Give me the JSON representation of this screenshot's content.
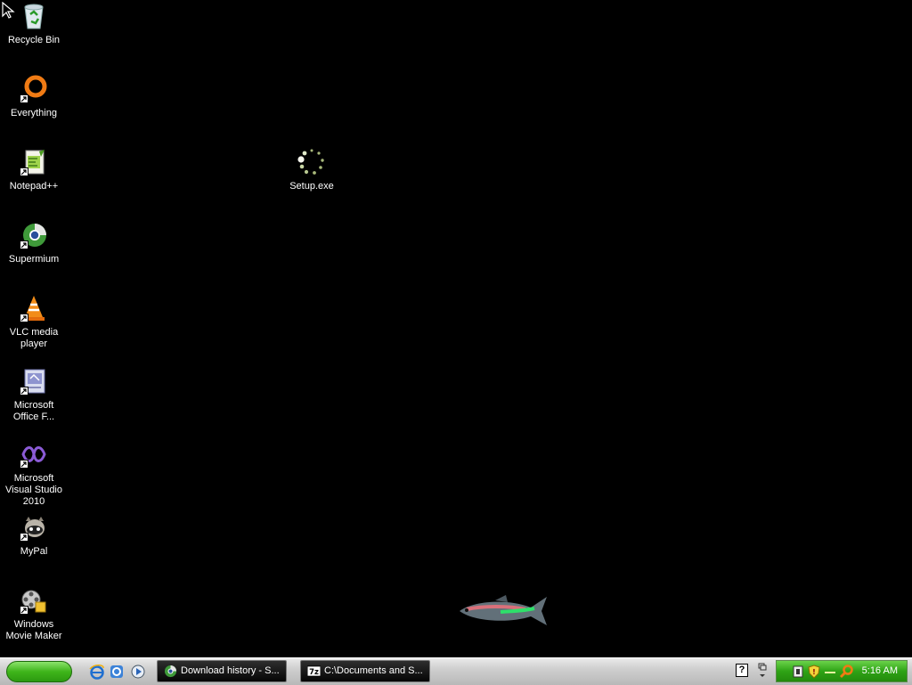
{
  "desktop": {
    "icons": [
      {
        "label": "Recycle Bin",
        "icon": "recycle-bin-icon"
      },
      {
        "label": "Everything",
        "icon": "everything-icon"
      },
      {
        "label": "Notepad++",
        "icon": "notepadpp-icon"
      },
      {
        "label": "Supermium",
        "icon": "supermium-icon"
      },
      {
        "label": "VLC media player",
        "icon": "vlc-icon"
      },
      {
        "label": "Microsoft Office F...",
        "icon": "office-icon"
      },
      {
        "label": "Microsoft Visual Studio 2010",
        "icon": "visual-studio-icon"
      },
      {
        "label": "MyPal",
        "icon": "mypal-icon"
      },
      {
        "label": "Windows Movie Maker",
        "icon": "movie-maker-icon"
      },
      {
        "label": "Setup.exe",
        "icon": "setup-loading-icon"
      }
    ]
  },
  "taskbar": {
    "tasks": [
      {
        "label": "Download history - S...",
        "icon": "supermium-icon"
      },
      {
        "label": "C:\\Documents and S...",
        "icon": "7zip-icon"
      }
    ],
    "help_label": "?",
    "clock": "5:16 AM"
  },
  "colors": {
    "desktop_bg": "#000000",
    "start_green": "#3fb51b",
    "tray_green": "#2fa316"
  }
}
